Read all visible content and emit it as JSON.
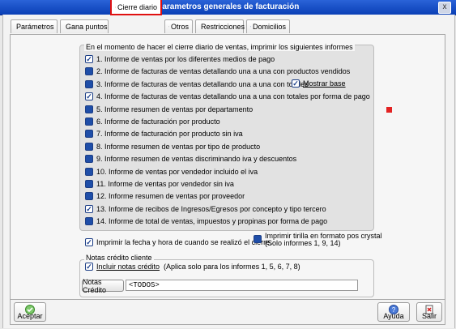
{
  "window": {
    "title": "Parametros generales de facturación",
    "close": "x"
  },
  "tabs": [
    {
      "label": "Parámetros",
      "icon": "info-icon"
    },
    {
      "label": "Gana puntos",
      "icon": "list-icon"
    },
    {
      "label": "Cierre diario",
      "icon": "gear-icon",
      "active": true
    },
    {
      "label": "Otros",
      "icon": "document-icon"
    },
    {
      "label": "Restricciones",
      "icon": "document-icon"
    },
    {
      "label": "Domicilios",
      "icon": "table-icon"
    }
  ],
  "group_title": "En el momento de hacer el cierre diario de ventas, imprimir los siguientes informes",
  "reports": [
    {
      "label": "1. Informe de ventas por los diferentes medios de pago",
      "checked": true
    },
    {
      "label": "2. Informe de facturas de ventas detallando una a una con productos vendidos",
      "checked": false
    },
    {
      "label": "3. Informe de facturas de ventas detallando una a una con totales",
      "checked": false
    },
    {
      "label": "4. Informe de facturas de ventas detallando una a una con totales por forma de pago",
      "checked": true
    },
    {
      "label": "5. Informe  resumen de ventas por departamento",
      "checked": false
    },
    {
      "label": "6. Informe de facturación por producto",
      "checked": false
    },
    {
      "label": "7. Informe de facturación por producto sin iva",
      "checked": false
    },
    {
      "label": "8. Informe resumen de ventas por tipo de producto",
      "checked": false
    },
    {
      "label": "9. Informe resumen de ventas discriminando iva y descuentos",
      "checked": false
    },
    {
      "label": "10. Informe de ventas por vendedor incluido el iva",
      "checked": false
    },
    {
      "label": "11. Informe de ventas por vendedor sin iva",
      "checked": false
    },
    {
      "label": "12. Informe resumen de ventas por proveedor",
      "checked": false
    },
    {
      "label": "13. Informe de recibos de Ingresos/Egresos por concepto y tipo tercero",
      "checked": true
    },
    {
      "label": "14. Informe de total de ventas, impuestos y propinas por forma de pago",
      "checked": false
    }
  ],
  "mostrar_base": {
    "label": "Mostrar base",
    "checked": true
  },
  "print_date": {
    "label": "Imprimir la fecha y hora de cuando se realizó el cierre.",
    "checked": true
  },
  "print_crystal": {
    "label_line1": "Imprimir tirilla en formato pos crystal",
    "label_line2": "(Solo informes 1, 9, 14)",
    "checked": false
  },
  "notes": {
    "title": "Notas crédito cliente",
    "include_label": "Incluir notas crédito",
    "include_hint": "(Aplica solo para los informes 1, 5, 6, 7, 8)",
    "include_checked": true,
    "button_label": "Notas Crédito",
    "value": "<TODOS>"
  },
  "footer": {
    "accept": "Aceptar",
    "help": "Ayuda",
    "exit": "Salir"
  }
}
